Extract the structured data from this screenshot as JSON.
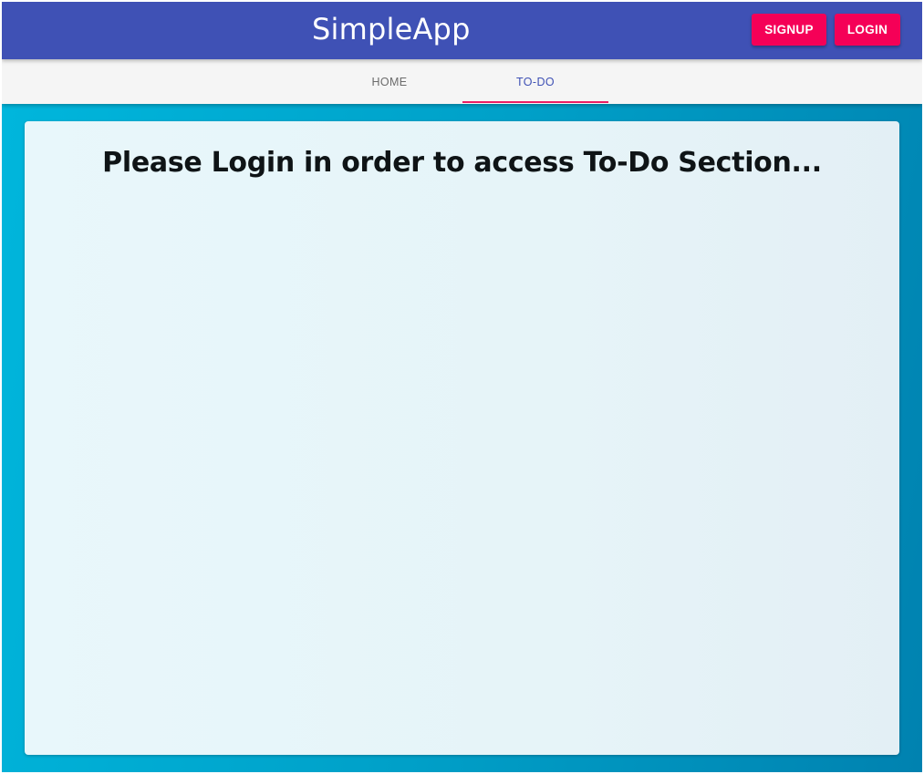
{
  "app_bar": {
    "title": "SimpleApp",
    "color": "#3f51b5",
    "buttons": {
      "signup_label": "SIGNUP",
      "login_label": "LOGIN",
      "color": "#f50057"
    }
  },
  "tabs": {
    "items": [
      {
        "label": "HOME",
        "selected": false
      },
      {
        "label": "TO-DO",
        "selected": true
      }
    ],
    "indicator_color": "#e91e63"
  },
  "main": {
    "message": "Please Login in order to access To-Do Section..."
  }
}
